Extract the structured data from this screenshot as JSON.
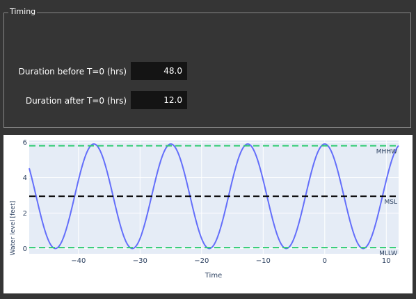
{
  "timing": {
    "title": "Timing",
    "before_label": "Duration before T=0 (hrs)",
    "before_value": "48.0",
    "after_label": "Duration after T=0 (hrs)",
    "after_value": "12.0"
  },
  "chart_data": {
    "type": "line",
    "xlabel": "Time",
    "ylabel": "Water level [feet]",
    "xlim": [
      -48,
      12
    ],
    "ylim": [
      -0.3,
      6.1
    ],
    "x_ticks": [
      -40,
      -30,
      -20,
      -10,
      0,
      10
    ],
    "x_tick_labels": [
      "−40",
      "−30",
      "−20",
      "−10",
      "0",
      "10"
    ],
    "y_ticks": [
      0,
      2,
      4,
      6
    ],
    "y_tick_labels": [
      "0",
      "2",
      "4",
      "6"
    ],
    "grid": true,
    "series": [
      {
        "name": "",
        "color": "#636efa",
        "function": "cosine",
        "mean": 2.95,
        "amplitude": 2.95,
        "period_hours": 12.5,
        "peak_at_hours": 0
      }
    ],
    "reference_lines": [
      {
        "label": "MHHW",
        "value": 5.8,
        "color": "#2ecc71",
        "dash": true
      },
      {
        "label": "MSL",
        "value": 2.95,
        "color": "#000000",
        "dash": true
      },
      {
        "label": "MLLW",
        "value": 0.05,
        "color": "#2ecc71",
        "dash": true
      }
    ],
    "plot_background": "#e5ecf6",
    "grid_color": "#ffffff"
  }
}
